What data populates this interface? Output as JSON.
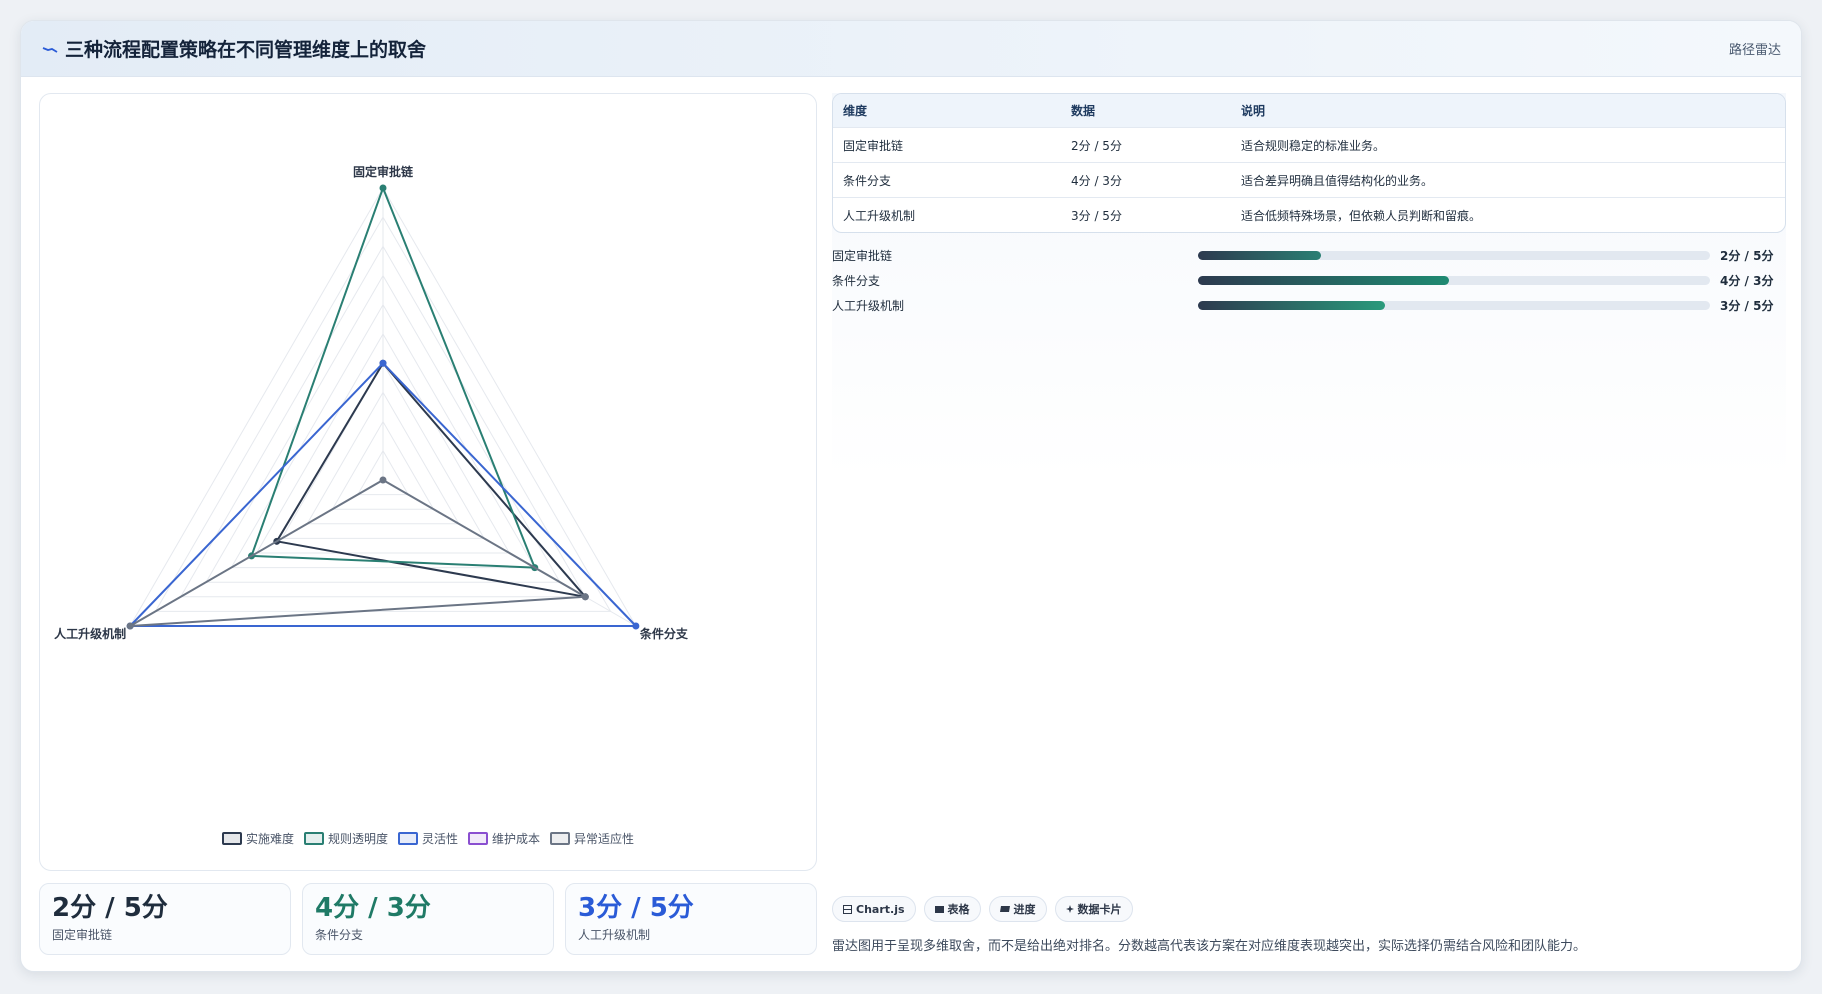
{
  "header": {
    "title": "三种流程配置策略在不同管理维度上的取舍",
    "tag": "路径雷达"
  },
  "chart_data": {
    "type": "radar",
    "axes": [
      "固定审批链",
      "条件分支",
      "人工升级机制"
    ],
    "rmax": 5,
    "rings": 10,
    "series": [
      {
        "name": "实施难度",
        "color": "#2d3a4f",
        "values": [
          2,
          4,
          2.1
        ]
      },
      {
        "name": "规则透明度",
        "color": "#2a7f73",
        "values": [
          5,
          3,
          2.6
        ]
      },
      {
        "name": "灵活性",
        "color": "#3a66d1",
        "values": [
          2,
          5,
          5
        ]
      },
      {
        "name": "维护成本",
        "color": "#8a4fd0",
        "values": [
          0,
          0,
          0
        ]
      },
      {
        "name": "异常适应性",
        "color": "#6b7585",
        "values": [
          0,
          4,
          5
        ]
      }
    ],
    "legend_position": "bottom"
  },
  "table": {
    "headers": [
      "维度",
      "数据",
      "说明"
    ],
    "rows": [
      {
        "dim": "固定审批链",
        "value": "2分 / 5分",
        "note": "适合规则稳定的标准业务。"
      },
      {
        "dim": "条件分支",
        "value": "4分 / 3分",
        "note": "适合差异明确且值得结构化的业务。"
      },
      {
        "dim": "人工升级机制",
        "value": "3分 / 5分",
        "note": "适合低频特殊场景，但依赖人员判断和留痕。"
      }
    ]
  },
  "bars": [
    {
      "label": "固定审批链",
      "value": "2分 / 5分",
      "fraction": 0.24,
      "color_from": "#2d3a4f",
      "color_to": "#2a7f73"
    },
    {
      "label": "条件分支",
      "value": "4分 / 3分",
      "fraction": 0.49,
      "color_from": "#2d3a4f",
      "color_to": "#1f8a72"
    },
    {
      "label": "人工升级机制",
      "value": "3分 / 5分",
      "fraction": 0.366,
      "color_from": "#2d3a4f",
      "color_to": "#2a9a7c"
    }
  ],
  "kpis": [
    {
      "value": "2分 / 5分",
      "label": "固定审批链",
      "color": "#1f2d3d"
    },
    {
      "value": "4分 / 3分",
      "label": "条件分支",
      "color": "#1f7a66"
    },
    {
      "value": "3分 / 5分",
      "label": "人工升级机制",
      "color": "#2a5bd7"
    }
  ],
  "chips": [
    {
      "icon": "chart-icon",
      "label": "Chart.js"
    },
    {
      "icon": "table-icon",
      "label": "表格"
    },
    {
      "icon": "progress-icon",
      "label": "进度"
    },
    {
      "icon": "card-icon",
      "label": "数据卡片"
    }
  ],
  "footnote": "雷达图用于呈现多维取舍，而不是给出绝对排名。分数越高代表该方案在对应维度表现越突出，实际选择仍需结合风险和团队能力。"
}
